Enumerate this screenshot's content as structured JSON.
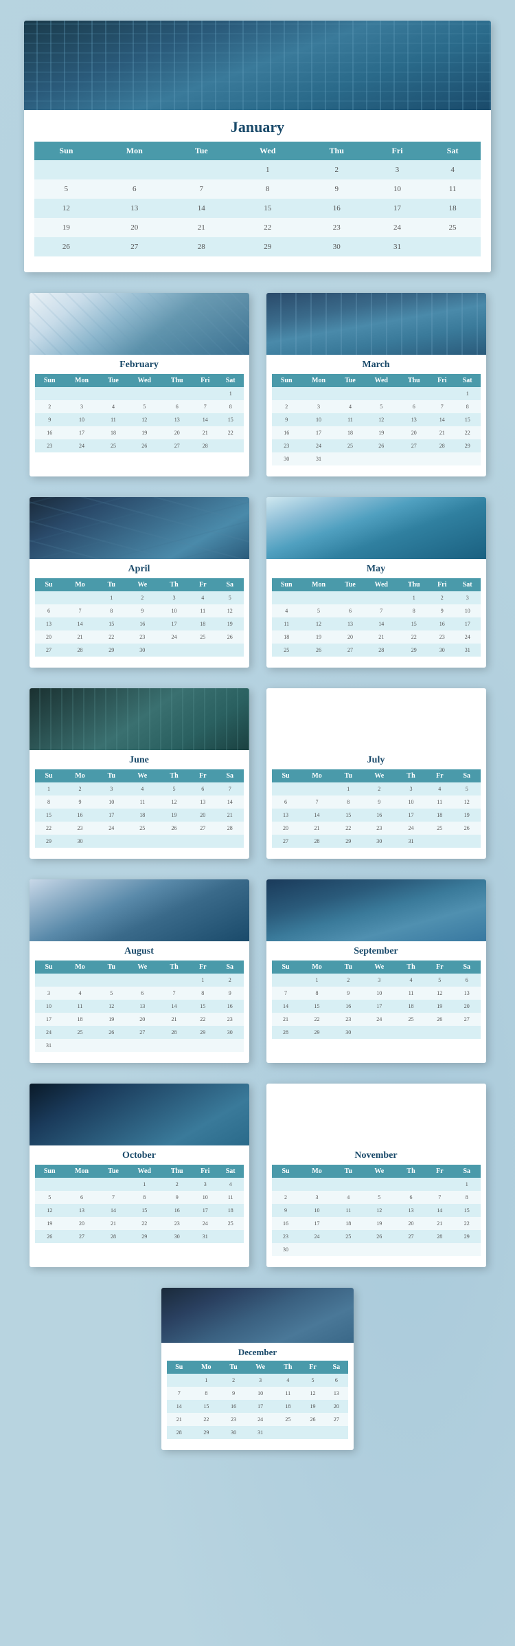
{
  "months": {
    "january": {
      "name": "January",
      "headers_full": [
        "Sun",
        "Mon",
        "Tue",
        "Wed",
        "Thu",
        "Fri",
        "Sat"
      ],
      "weeks": [
        [
          "",
          "",
          "",
          "1",
          "2",
          "3",
          "4"
        ],
        [
          "5",
          "6",
          "7",
          "8",
          "9",
          "10",
          "11"
        ],
        [
          "12",
          "13",
          "14",
          "15",
          "16",
          "17",
          "18"
        ],
        [
          "19",
          "20",
          "21",
          "22",
          "23",
          "24",
          "25"
        ],
        [
          "26",
          "27",
          "28",
          "29",
          "30",
          "31",
          ""
        ]
      ]
    },
    "february": {
      "name": "February",
      "headers": [
        "Sun",
        "Mon",
        "Tue",
        "Wed",
        "Thu",
        "Fri",
        "Sat"
      ],
      "weeks": [
        [
          "",
          "",
          "",
          "",
          "",
          "",
          "1"
        ],
        [
          "2",
          "3",
          "4",
          "5",
          "6",
          "7",
          "8"
        ],
        [
          "9",
          "10",
          "11",
          "12",
          "13",
          "14",
          "15"
        ],
        [
          "16",
          "17",
          "18",
          "19",
          "20",
          "21",
          "22"
        ],
        [
          "23",
          "24",
          "25",
          "26",
          "27",
          "28",
          ""
        ]
      ]
    },
    "march": {
      "name": "March",
      "headers": [
        "Sun",
        "Mon",
        "Tue",
        "Wed",
        "Thu",
        "Fri",
        "Sat"
      ],
      "weeks": [
        [
          "",
          "",
          "",
          "",
          "",
          "",
          "1"
        ],
        [
          "2",
          "3",
          "4",
          "5",
          "6",
          "7",
          "8"
        ],
        [
          "9",
          "10",
          "11",
          "12",
          "13",
          "14",
          "15"
        ],
        [
          "16",
          "17",
          "18",
          "19",
          "20",
          "21",
          "22"
        ],
        [
          "23",
          "24",
          "25",
          "26",
          "27",
          "28",
          "29"
        ],
        [
          "30",
          "31",
          "",
          "",
          "",
          "",
          ""
        ]
      ]
    },
    "april": {
      "name": "April",
      "headers": [
        "Su",
        "Mo",
        "Tu",
        "We",
        "Th",
        "Fr",
        "Sa"
      ],
      "weeks": [
        [
          "",
          "",
          "1",
          "2",
          "3",
          "4",
          "5"
        ],
        [
          "6",
          "7",
          "8",
          "9",
          "10",
          "11",
          "12"
        ],
        [
          "13",
          "14",
          "15",
          "16",
          "17",
          "18",
          "19"
        ],
        [
          "20",
          "21",
          "22",
          "23",
          "24",
          "25",
          "26"
        ],
        [
          "27",
          "28",
          "29",
          "30",
          "",
          "",
          ""
        ]
      ]
    },
    "may": {
      "name": "May",
      "headers": [
        "Sun",
        "Mon",
        "Tue",
        "Wed",
        "Thu",
        "Fri",
        "Sat"
      ],
      "weeks": [
        [
          "",
          "",
          "",
          "",
          "1",
          "2",
          "3"
        ],
        [
          "4",
          "5",
          "6",
          "7",
          "8",
          "9",
          "10"
        ],
        [
          "11",
          "12",
          "13",
          "14",
          "15",
          "16",
          "17"
        ],
        [
          "18",
          "19",
          "20",
          "21",
          "22",
          "23",
          "24"
        ],
        [
          "25",
          "26",
          "27",
          "28",
          "29",
          "30",
          "31"
        ]
      ]
    },
    "june": {
      "name": "June",
      "headers": [
        "Su",
        "Mo",
        "Tu",
        "We",
        "Th",
        "Fr",
        "Sa"
      ],
      "weeks": [
        [
          "1",
          "2",
          "3",
          "4",
          "5",
          "6",
          "7"
        ],
        [
          "8",
          "9",
          "10",
          "11",
          "12",
          "13",
          "14"
        ],
        [
          "15",
          "16",
          "17",
          "18",
          "19",
          "20",
          "21"
        ],
        [
          "22",
          "23",
          "24",
          "25",
          "26",
          "27",
          "28"
        ],
        [
          "29",
          "30",
          "",
          "",
          "",
          "",
          ""
        ]
      ]
    },
    "july": {
      "name": "July",
      "headers": [
        "Su",
        "Mo",
        "Tu",
        "We",
        "Th",
        "Fr",
        "Sa"
      ],
      "weeks": [
        [
          "",
          "",
          "1",
          "2",
          "3",
          "4",
          "5"
        ],
        [
          "6",
          "7",
          "8",
          "9",
          "10",
          "11",
          "12"
        ],
        [
          "13",
          "14",
          "15",
          "16",
          "17",
          "18",
          "19"
        ],
        [
          "20",
          "21",
          "22",
          "23",
          "24",
          "25",
          "26"
        ],
        [
          "27",
          "28",
          "29",
          "30",
          "31",
          "",
          ""
        ]
      ]
    },
    "august": {
      "name": "August",
      "headers": [
        "Su",
        "Mo",
        "Tu",
        "We",
        "Th",
        "Fr",
        "Sa"
      ],
      "weeks": [
        [
          "",
          "",
          "",
          "",
          "",
          "1",
          "2"
        ],
        [
          "3",
          "4",
          "5",
          "6",
          "7",
          "8",
          "9"
        ],
        [
          "10",
          "11",
          "12",
          "13",
          "14",
          "15",
          "16"
        ],
        [
          "17",
          "18",
          "19",
          "20",
          "21",
          "22",
          "23"
        ],
        [
          "24",
          "25",
          "26",
          "27",
          "28",
          "29",
          "30"
        ],
        [
          "31",
          "",
          "",
          "",
          "",
          "",
          ""
        ]
      ]
    },
    "september": {
      "name": "September",
      "headers": [
        "Su",
        "Mo",
        "Tu",
        "We",
        "Th",
        "Fr",
        "Sa"
      ],
      "weeks": [
        [
          "",
          "1",
          "2",
          "3",
          "4",
          "5",
          "6"
        ],
        [
          "7",
          "8",
          "9",
          "10",
          "11",
          "12",
          "13"
        ],
        [
          "14",
          "15",
          "16",
          "17",
          "18",
          "19",
          "20"
        ],
        [
          "21",
          "22",
          "23",
          "24",
          "25",
          "26",
          "27"
        ],
        [
          "28",
          "29",
          "30",
          "",
          "",
          "",
          ""
        ]
      ]
    },
    "october": {
      "name": "October",
      "headers": [
        "Sun",
        "Mon",
        "Tue",
        "Wed",
        "Thu",
        "Fri",
        "Sat"
      ],
      "weeks": [
        [
          "",
          "",
          "",
          "1",
          "2",
          "3",
          "4"
        ],
        [
          "5",
          "6",
          "7",
          "8",
          "9",
          "10",
          "11"
        ],
        [
          "12",
          "13",
          "14",
          "15",
          "16",
          "17",
          "18"
        ],
        [
          "19",
          "20",
          "21",
          "22",
          "23",
          "24",
          "25"
        ],
        [
          "26",
          "27",
          "28",
          "29",
          "30",
          "31",
          ""
        ]
      ]
    },
    "november": {
      "name": "November",
      "headers": [
        "Su",
        "Mo",
        "Tu",
        "We",
        "Th",
        "Fr",
        "Sa"
      ],
      "weeks": [
        [
          "",
          "",
          "",
          "",
          "",
          "",
          "1"
        ],
        [
          "2",
          "3",
          "4",
          "5",
          "6",
          "7",
          "8"
        ],
        [
          "9",
          "10",
          "11",
          "12",
          "13",
          "14",
          "15"
        ],
        [
          "16",
          "17",
          "18",
          "19",
          "20",
          "21",
          "22"
        ],
        [
          "23",
          "24",
          "25",
          "26",
          "27",
          "28",
          "29"
        ],
        [
          "30",
          "",
          "",
          "",
          "",
          "",
          ""
        ]
      ]
    },
    "december": {
      "name": "December",
      "headers": [
        "Su",
        "Mo",
        "Tu",
        "We",
        "Th",
        "Fr",
        "Sa"
      ],
      "weeks": [
        [
          "",
          "1",
          "2",
          "3",
          "4",
          "5",
          "6"
        ],
        [
          "7",
          "8",
          "9",
          "10",
          "11",
          "12",
          "13"
        ],
        [
          "14",
          "15",
          "16",
          "17",
          "18",
          "19",
          "20"
        ],
        [
          "21",
          "22",
          "23",
          "24",
          "25",
          "26",
          "27"
        ],
        [
          "28",
          "29",
          "30",
          "31",
          "",
          "",
          ""
        ]
      ]
    }
  }
}
